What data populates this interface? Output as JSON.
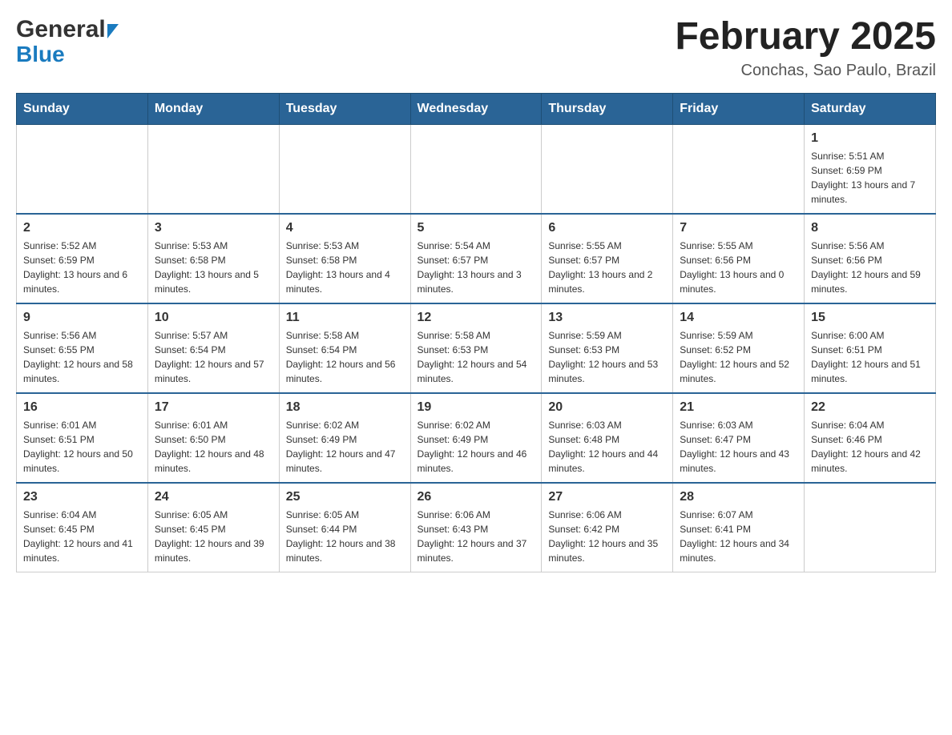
{
  "header": {
    "logo_general": "General",
    "logo_blue": "Blue",
    "title": "February 2025",
    "location": "Conchas, Sao Paulo, Brazil"
  },
  "days_of_week": [
    "Sunday",
    "Monday",
    "Tuesday",
    "Wednesday",
    "Thursday",
    "Friday",
    "Saturday"
  ],
  "weeks": [
    {
      "days": [
        {
          "num": "",
          "sunrise": "",
          "sunset": "",
          "daylight": ""
        },
        {
          "num": "",
          "sunrise": "",
          "sunset": "",
          "daylight": ""
        },
        {
          "num": "",
          "sunrise": "",
          "sunset": "",
          "daylight": ""
        },
        {
          "num": "",
          "sunrise": "",
          "sunset": "",
          "daylight": ""
        },
        {
          "num": "",
          "sunrise": "",
          "sunset": "",
          "daylight": ""
        },
        {
          "num": "",
          "sunrise": "",
          "sunset": "",
          "daylight": ""
        },
        {
          "num": "1",
          "sunrise": "Sunrise: 5:51 AM",
          "sunset": "Sunset: 6:59 PM",
          "daylight": "Daylight: 13 hours and 7 minutes."
        }
      ]
    },
    {
      "days": [
        {
          "num": "2",
          "sunrise": "Sunrise: 5:52 AM",
          "sunset": "Sunset: 6:59 PM",
          "daylight": "Daylight: 13 hours and 6 minutes."
        },
        {
          "num": "3",
          "sunrise": "Sunrise: 5:53 AM",
          "sunset": "Sunset: 6:58 PM",
          "daylight": "Daylight: 13 hours and 5 minutes."
        },
        {
          "num": "4",
          "sunrise": "Sunrise: 5:53 AM",
          "sunset": "Sunset: 6:58 PM",
          "daylight": "Daylight: 13 hours and 4 minutes."
        },
        {
          "num": "5",
          "sunrise": "Sunrise: 5:54 AM",
          "sunset": "Sunset: 6:57 PM",
          "daylight": "Daylight: 13 hours and 3 minutes."
        },
        {
          "num": "6",
          "sunrise": "Sunrise: 5:55 AM",
          "sunset": "Sunset: 6:57 PM",
          "daylight": "Daylight: 13 hours and 2 minutes."
        },
        {
          "num": "7",
          "sunrise": "Sunrise: 5:55 AM",
          "sunset": "Sunset: 6:56 PM",
          "daylight": "Daylight: 13 hours and 0 minutes."
        },
        {
          "num": "8",
          "sunrise": "Sunrise: 5:56 AM",
          "sunset": "Sunset: 6:56 PM",
          "daylight": "Daylight: 12 hours and 59 minutes."
        }
      ]
    },
    {
      "days": [
        {
          "num": "9",
          "sunrise": "Sunrise: 5:56 AM",
          "sunset": "Sunset: 6:55 PM",
          "daylight": "Daylight: 12 hours and 58 minutes."
        },
        {
          "num": "10",
          "sunrise": "Sunrise: 5:57 AM",
          "sunset": "Sunset: 6:54 PM",
          "daylight": "Daylight: 12 hours and 57 minutes."
        },
        {
          "num": "11",
          "sunrise": "Sunrise: 5:58 AM",
          "sunset": "Sunset: 6:54 PM",
          "daylight": "Daylight: 12 hours and 56 minutes."
        },
        {
          "num": "12",
          "sunrise": "Sunrise: 5:58 AM",
          "sunset": "Sunset: 6:53 PM",
          "daylight": "Daylight: 12 hours and 54 minutes."
        },
        {
          "num": "13",
          "sunrise": "Sunrise: 5:59 AM",
          "sunset": "Sunset: 6:53 PM",
          "daylight": "Daylight: 12 hours and 53 minutes."
        },
        {
          "num": "14",
          "sunrise": "Sunrise: 5:59 AM",
          "sunset": "Sunset: 6:52 PM",
          "daylight": "Daylight: 12 hours and 52 minutes."
        },
        {
          "num": "15",
          "sunrise": "Sunrise: 6:00 AM",
          "sunset": "Sunset: 6:51 PM",
          "daylight": "Daylight: 12 hours and 51 minutes."
        }
      ]
    },
    {
      "days": [
        {
          "num": "16",
          "sunrise": "Sunrise: 6:01 AM",
          "sunset": "Sunset: 6:51 PM",
          "daylight": "Daylight: 12 hours and 50 minutes."
        },
        {
          "num": "17",
          "sunrise": "Sunrise: 6:01 AM",
          "sunset": "Sunset: 6:50 PM",
          "daylight": "Daylight: 12 hours and 48 minutes."
        },
        {
          "num": "18",
          "sunrise": "Sunrise: 6:02 AM",
          "sunset": "Sunset: 6:49 PM",
          "daylight": "Daylight: 12 hours and 47 minutes."
        },
        {
          "num": "19",
          "sunrise": "Sunrise: 6:02 AM",
          "sunset": "Sunset: 6:49 PM",
          "daylight": "Daylight: 12 hours and 46 minutes."
        },
        {
          "num": "20",
          "sunrise": "Sunrise: 6:03 AM",
          "sunset": "Sunset: 6:48 PM",
          "daylight": "Daylight: 12 hours and 44 minutes."
        },
        {
          "num": "21",
          "sunrise": "Sunrise: 6:03 AM",
          "sunset": "Sunset: 6:47 PM",
          "daylight": "Daylight: 12 hours and 43 minutes."
        },
        {
          "num": "22",
          "sunrise": "Sunrise: 6:04 AM",
          "sunset": "Sunset: 6:46 PM",
          "daylight": "Daylight: 12 hours and 42 minutes."
        }
      ]
    },
    {
      "days": [
        {
          "num": "23",
          "sunrise": "Sunrise: 6:04 AM",
          "sunset": "Sunset: 6:45 PM",
          "daylight": "Daylight: 12 hours and 41 minutes."
        },
        {
          "num": "24",
          "sunrise": "Sunrise: 6:05 AM",
          "sunset": "Sunset: 6:45 PM",
          "daylight": "Daylight: 12 hours and 39 minutes."
        },
        {
          "num": "25",
          "sunrise": "Sunrise: 6:05 AM",
          "sunset": "Sunset: 6:44 PM",
          "daylight": "Daylight: 12 hours and 38 minutes."
        },
        {
          "num": "26",
          "sunrise": "Sunrise: 6:06 AM",
          "sunset": "Sunset: 6:43 PM",
          "daylight": "Daylight: 12 hours and 37 minutes."
        },
        {
          "num": "27",
          "sunrise": "Sunrise: 6:06 AM",
          "sunset": "Sunset: 6:42 PM",
          "daylight": "Daylight: 12 hours and 35 minutes."
        },
        {
          "num": "28",
          "sunrise": "Sunrise: 6:07 AM",
          "sunset": "Sunset: 6:41 PM",
          "daylight": "Daylight: 12 hours and 34 minutes."
        },
        {
          "num": "",
          "sunrise": "",
          "sunset": "",
          "daylight": ""
        }
      ]
    }
  ]
}
